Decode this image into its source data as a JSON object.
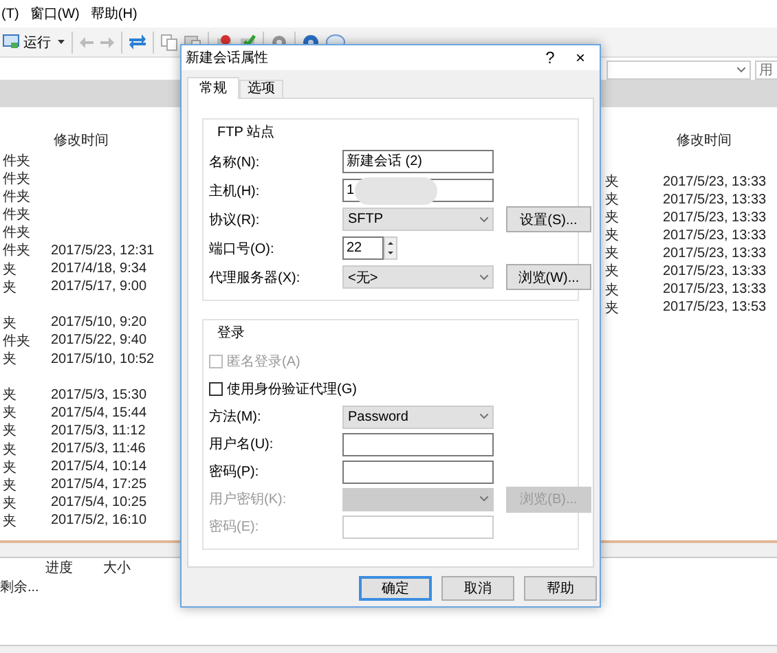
{
  "app": {
    "menu": [
      "(T)",
      "窗口(W)",
      "帮助(H)"
    ],
    "toolbar": {
      "run_label": "运行"
    },
    "remote_path": {
      "user_placeholder": "用"
    },
    "left_pane": {
      "columns": [
        "修改时间"
      ],
      "rows": [
        {
          "type": "件夹",
          "modified": ""
        },
        {
          "type": "件夹",
          "modified": ""
        },
        {
          "type": "件夹",
          "modified": ""
        },
        {
          "type": "件夹",
          "modified": ""
        },
        {
          "type": "件夹",
          "modified": ""
        },
        {
          "type": "件夹",
          "modified": "2017/5/23, 12:31"
        },
        {
          "type": "夹",
          "modified": "2017/4/18, 9:34"
        },
        {
          "type": "夹",
          "modified": "2017/5/17, 9:00"
        },
        {
          "type": "",
          "modified": ""
        },
        {
          "type": "夹",
          "modified": "2017/5/10, 9:20"
        },
        {
          "type": "件夹",
          "modified": "2017/5/22, 9:40"
        },
        {
          "type": "夹",
          "modified": "2017/5/10, 10:52"
        },
        {
          "type": "",
          "modified": ""
        },
        {
          "type": "夹",
          "modified": "2017/5/3, 15:30"
        },
        {
          "type": "夹",
          "modified": "2017/5/4, 15:44"
        },
        {
          "type": "夹",
          "modified": "2017/5/3, 11:12"
        },
        {
          "type": "夹",
          "modified": "2017/5/3, 11:46"
        },
        {
          "type": "夹",
          "modified": "2017/5/4, 10:14"
        },
        {
          "type": "夹",
          "modified": "2017/5/4, 17:25"
        },
        {
          "type": "夹",
          "modified": "2017/5/4, 10:25"
        },
        {
          "type": "夹",
          "modified": "2017/5/2, 16:10"
        }
      ]
    },
    "right_pane": {
      "columns": [
        "修改时间"
      ],
      "rows": [
        {
          "type": "夹",
          "modified": "2017/5/23, 13:33"
        },
        {
          "type": "夹",
          "modified": "2017/5/23, 13:33"
        },
        {
          "type": "夹",
          "modified": "2017/5/23, 13:33"
        },
        {
          "type": "夹",
          "modified": "2017/5/23, 13:33"
        },
        {
          "type": "夹",
          "modified": "2017/5/23, 13:33"
        },
        {
          "type": "夹",
          "modified": "2017/5/23, 13:33"
        },
        {
          "type": "夹",
          "modified": "2017/5/23, 13:33"
        },
        {
          "type": "夹",
          "modified": "2017/5/23, 13:53"
        }
      ]
    },
    "queue": {
      "columns": [
        "进度",
        "大小"
      ],
      "right_column": "剩余..."
    }
  },
  "dialog": {
    "title": "新建会话属性",
    "help_glyph": "?",
    "close_glyph": "×",
    "tabs": [
      {
        "label": "常规",
        "selected": true
      },
      {
        "label": "选项",
        "selected": false
      }
    ],
    "site_group": {
      "title": "FTP 站点",
      "fields": [
        {
          "kind": "text",
          "label": "名称(N):",
          "value": "新建会话 (2)"
        },
        {
          "kind": "text",
          "label": "主机(H):",
          "value": "1",
          "redacted": true
        },
        {
          "kind": "select",
          "label": "协议(R):",
          "value": "SFTP",
          "button": "设置(S)..."
        },
        {
          "kind": "spin",
          "label": "端口号(O):",
          "value": "22"
        },
        {
          "kind": "select",
          "label": "代理服务器(X):",
          "value": "<无>",
          "button": "浏览(W)..."
        }
      ]
    },
    "login_group": {
      "title": "登录",
      "fields": [
        {
          "kind": "checkbox",
          "label": "匿名登录(A)",
          "checked": false,
          "disabled": true
        },
        {
          "kind": "checkbox",
          "label": "使用身份验证代理(G)",
          "checked": false,
          "disabled": false
        },
        {
          "kind": "select",
          "label": "方法(M):",
          "value": "Password",
          "disabled": false
        },
        {
          "kind": "text",
          "label": "用户名(U):",
          "disabled": false
        },
        {
          "kind": "text",
          "label": "密码(P):",
          "disabled": false
        },
        {
          "kind": "select",
          "label": "用户密钥(K):",
          "disabled": true,
          "button": "浏览(B)..."
        },
        {
          "kind": "text",
          "label": "密码(E):",
          "disabled": true
        }
      ]
    },
    "buttons": [
      {
        "label": "确定",
        "default": true
      },
      {
        "label": "取消",
        "default": false
      },
      {
        "label": "帮助",
        "default": false
      }
    ]
  }
}
